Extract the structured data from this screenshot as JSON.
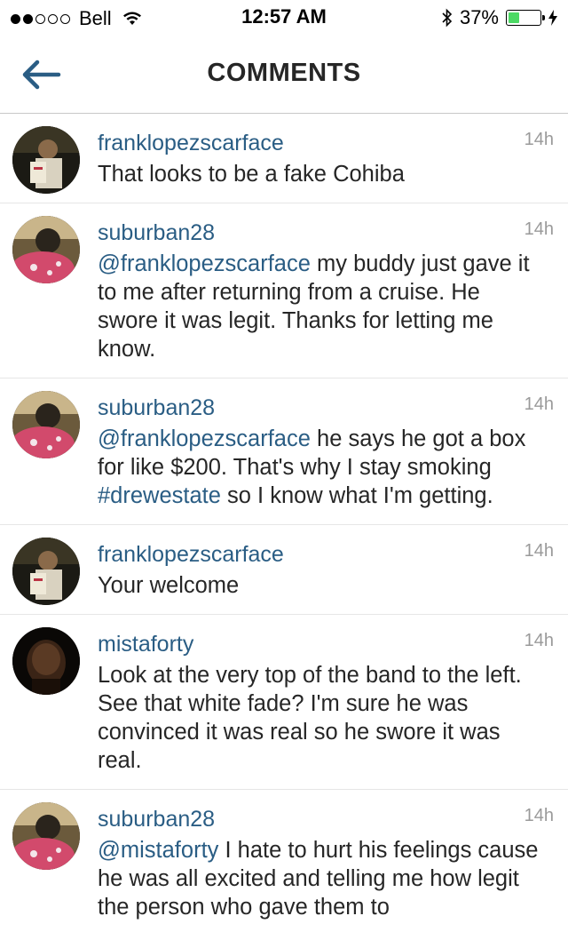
{
  "status_bar": {
    "carrier": "Bell",
    "time": "12:57 AM",
    "battery_percent": "37%",
    "battery_level": 0.37,
    "signal_bars_filled": 2,
    "signal_bars_total": 5,
    "battery_color": "#4cd964"
  },
  "nav": {
    "title": "COMMENTS",
    "back_icon": "arrow-left-icon"
  },
  "colors": {
    "link": "#2a5d84",
    "timestamp": "#9a9a9a",
    "text": "#262626"
  },
  "comments": [
    {
      "username": "franklopezscarface",
      "time": "14h",
      "mention": "",
      "text_1": "That looks to be a fake Cohiba",
      "hashtag": "",
      "text_2": ""
    },
    {
      "username": "suburban28",
      "time": "14h",
      "mention": "@franklopezscarface",
      "text_1": " my buddy just gave it to me after returning from a cruise. He swore it was legit. Thanks for letting me know.",
      "hashtag": "",
      "text_2": ""
    },
    {
      "username": "suburban28",
      "time": "14h",
      "mention": "@franklopezscarface",
      "text_1": " he says he got a box for like $200. That's why I stay smoking ",
      "hashtag": "#drewestate",
      "text_2": " so I know what I'm getting."
    },
    {
      "username": "franklopezscarface",
      "time": "14h",
      "mention": "",
      "text_1": "Your welcome",
      "hashtag": "",
      "text_2": ""
    },
    {
      "username": "mistaforty",
      "time": "14h",
      "mention": "",
      "text_1": "Look at the very top of the band to the left.  See that white fade? I'm sure he was convinced it was real so he swore it was real.",
      "hashtag": "",
      "text_2": ""
    },
    {
      "username": "suburban28",
      "time": "14h",
      "mention": "@mistaforty",
      "text_1": " I hate to hurt his feelings cause he was all excited and telling me how legit the person who gave them to",
      "hashtag": "",
      "text_2": ""
    }
  ]
}
